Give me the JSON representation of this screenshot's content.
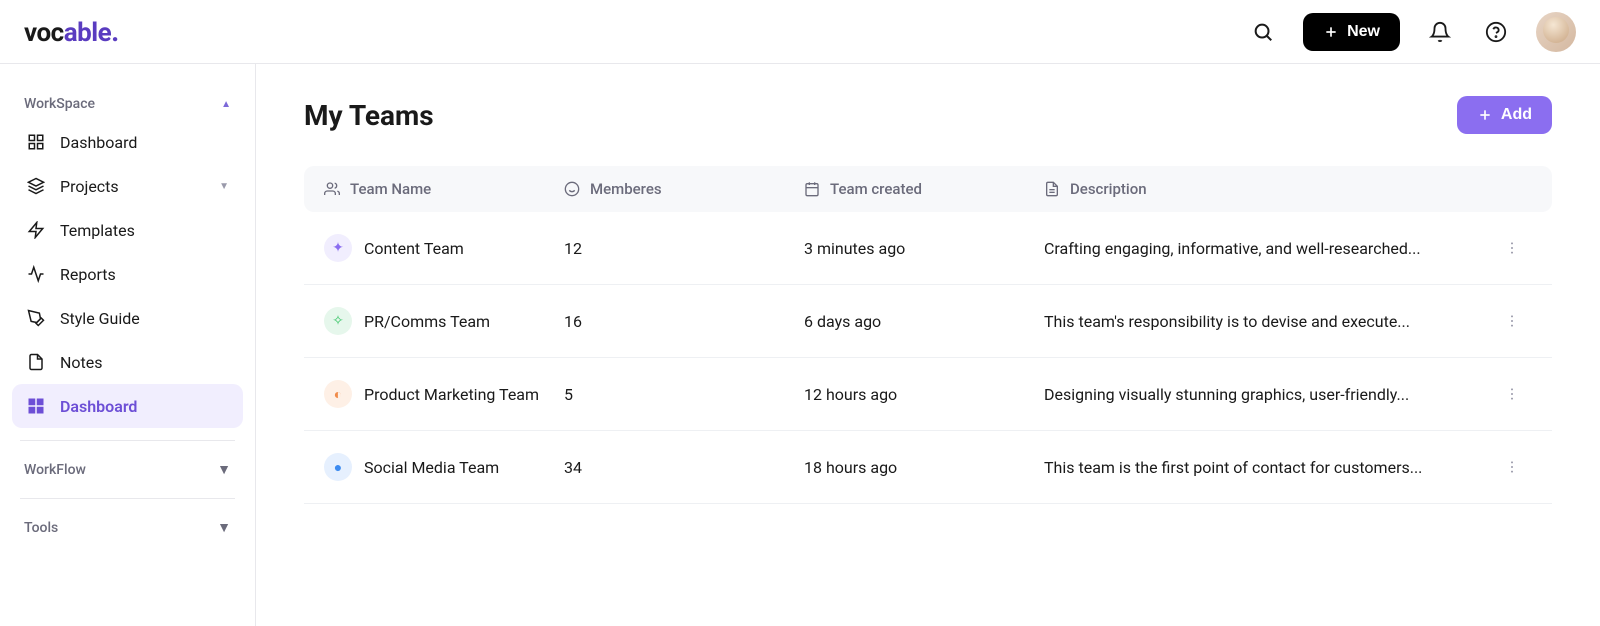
{
  "header": {
    "logo_text": "vocable.",
    "new_button_label": "New"
  },
  "sidebar": {
    "sections": {
      "workspace": {
        "label": "WorkSpace",
        "expanded": true,
        "items": [
          {
            "label": "Dashboard",
            "icon": "grid"
          },
          {
            "label": "Projects",
            "icon": "layers",
            "has_submenu": true
          },
          {
            "label": "Templates",
            "icon": "lightning"
          },
          {
            "label": "Reports",
            "icon": "activity"
          },
          {
            "label": "Style Guide",
            "icon": "pencil"
          },
          {
            "label": "Notes",
            "icon": "file"
          },
          {
            "label": "Dashboard",
            "icon": "grid",
            "active": true
          }
        ]
      },
      "workflow": {
        "label": "WorkFlow",
        "expanded": false
      },
      "tools": {
        "label": "Tools",
        "expanded": false
      }
    }
  },
  "page": {
    "title": "My Teams",
    "add_button_label": "Add"
  },
  "table": {
    "columns": {
      "name": "Team Name",
      "members": "Memberes",
      "created": "Team created",
      "description": "Description"
    },
    "rows": [
      {
        "icon": "purple",
        "symbol": "✦",
        "name": "Content Team",
        "members": "12",
        "created": "3 minutes ago",
        "description": "Crafting engaging, informative, and well-researched..."
      },
      {
        "icon": "green",
        "symbol": "✧",
        "name": "PR/Comms Team",
        "members": "16",
        "created": "6 days ago",
        "description": "This team's responsibility is to devise and execute..."
      },
      {
        "icon": "orange",
        "symbol": "◐",
        "name": "Product Marketing Team",
        "members": "5",
        "created": "12 hours ago",
        "description": "Designing visually stunning graphics, user-friendly..."
      },
      {
        "icon": "blue",
        "symbol": "●",
        "name": "Social Media Team",
        "members": "34",
        "created": "18 hours ago",
        "description": "This team is the first point of contact for customers..."
      }
    ]
  }
}
